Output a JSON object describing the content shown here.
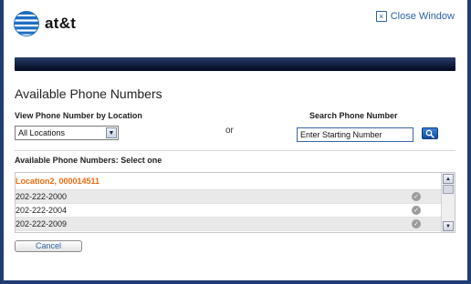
{
  "header": {
    "brand": "at&t",
    "close_label": "Close Window"
  },
  "page_title": "Available Phone Numbers",
  "location_filter": {
    "label": "View Phone Number by Location",
    "selected": "All Locations"
  },
  "or_text": "or",
  "search": {
    "label": "Search Phone Number",
    "value": "Enter Starting Number"
  },
  "list": {
    "label": "Available Phone Numbers: Select one",
    "group_label": "Location2, 000014511",
    "rows": [
      "202-222-2000",
      "202-222-2004",
      "202-222-2009"
    ]
  },
  "cancel_label": "Cancel",
  "colors": {
    "banner": "#0e1b3c",
    "link": "#2a62a8",
    "group_label": "#f26a10",
    "frame": "#1f3d73"
  },
  "icons": {
    "logo": "att-globe-icon",
    "close": "close-icon",
    "search": "search-icon",
    "select_arrow": "chevron-down-icon",
    "row_status": "check-circle-icon"
  }
}
